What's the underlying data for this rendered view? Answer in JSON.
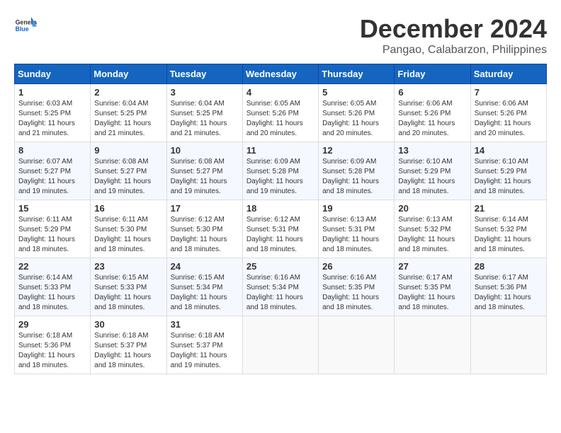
{
  "header": {
    "logo_line1": "General",
    "logo_line2": "Blue",
    "month_title": "December 2024",
    "subtitle": "Pangao, Calabarzon, Philippines"
  },
  "weekdays": [
    "Sunday",
    "Monday",
    "Tuesday",
    "Wednesday",
    "Thursday",
    "Friday",
    "Saturday"
  ],
  "weeks": [
    [
      {
        "day": "1",
        "sunrise": "6:03 AM",
        "sunset": "5:25 PM",
        "daylight": "11 hours and 21 minutes."
      },
      {
        "day": "2",
        "sunrise": "6:04 AM",
        "sunset": "5:25 PM",
        "daylight": "11 hours and 21 minutes."
      },
      {
        "day": "3",
        "sunrise": "6:04 AM",
        "sunset": "5:25 PM",
        "daylight": "11 hours and 21 minutes."
      },
      {
        "day": "4",
        "sunrise": "6:05 AM",
        "sunset": "5:26 PM",
        "daylight": "11 hours and 20 minutes."
      },
      {
        "day": "5",
        "sunrise": "6:05 AM",
        "sunset": "5:26 PM",
        "daylight": "11 hours and 20 minutes."
      },
      {
        "day": "6",
        "sunrise": "6:06 AM",
        "sunset": "5:26 PM",
        "daylight": "11 hours and 20 minutes."
      },
      {
        "day": "7",
        "sunrise": "6:06 AM",
        "sunset": "5:26 PM",
        "daylight": "11 hours and 20 minutes."
      }
    ],
    [
      {
        "day": "8",
        "sunrise": "6:07 AM",
        "sunset": "5:27 PM",
        "daylight": "11 hours and 19 minutes."
      },
      {
        "day": "9",
        "sunrise": "6:08 AM",
        "sunset": "5:27 PM",
        "daylight": "11 hours and 19 minutes."
      },
      {
        "day": "10",
        "sunrise": "6:08 AM",
        "sunset": "5:27 PM",
        "daylight": "11 hours and 19 minutes."
      },
      {
        "day": "11",
        "sunrise": "6:09 AM",
        "sunset": "5:28 PM",
        "daylight": "11 hours and 19 minutes."
      },
      {
        "day": "12",
        "sunrise": "6:09 AM",
        "sunset": "5:28 PM",
        "daylight": "11 hours and 18 minutes."
      },
      {
        "day": "13",
        "sunrise": "6:10 AM",
        "sunset": "5:29 PM",
        "daylight": "11 hours and 18 minutes."
      },
      {
        "day": "14",
        "sunrise": "6:10 AM",
        "sunset": "5:29 PM",
        "daylight": "11 hours and 18 minutes."
      }
    ],
    [
      {
        "day": "15",
        "sunrise": "6:11 AM",
        "sunset": "5:29 PM",
        "daylight": "11 hours and 18 minutes."
      },
      {
        "day": "16",
        "sunrise": "6:11 AM",
        "sunset": "5:30 PM",
        "daylight": "11 hours and 18 minutes."
      },
      {
        "day": "17",
        "sunrise": "6:12 AM",
        "sunset": "5:30 PM",
        "daylight": "11 hours and 18 minutes."
      },
      {
        "day": "18",
        "sunrise": "6:12 AM",
        "sunset": "5:31 PM",
        "daylight": "11 hours and 18 minutes."
      },
      {
        "day": "19",
        "sunrise": "6:13 AM",
        "sunset": "5:31 PM",
        "daylight": "11 hours and 18 minutes."
      },
      {
        "day": "20",
        "sunrise": "6:13 AM",
        "sunset": "5:32 PM",
        "daylight": "11 hours and 18 minutes."
      },
      {
        "day": "21",
        "sunrise": "6:14 AM",
        "sunset": "5:32 PM",
        "daylight": "11 hours and 18 minutes."
      }
    ],
    [
      {
        "day": "22",
        "sunrise": "6:14 AM",
        "sunset": "5:33 PM",
        "daylight": "11 hours and 18 minutes."
      },
      {
        "day": "23",
        "sunrise": "6:15 AM",
        "sunset": "5:33 PM",
        "daylight": "11 hours and 18 minutes."
      },
      {
        "day": "24",
        "sunrise": "6:15 AM",
        "sunset": "5:34 PM",
        "daylight": "11 hours and 18 minutes."
      },
      {
        "day": "25",
        "sunrise": "6:16 AM",
        "sunset": "5:34 PM",
        "daylight": "11 hours and 18 minutes."
      },
      {
        "day": "26",
        "sunrise": "6:16 AM",
        "sunset": "5:35 PM",
        "daylight": "11 hours and 18 minutes."
      },
      {
        "day": "27",
        "sunrise": "6:17 AM",
        "sunset": "5:35 PM",
        "daylight": "11 hours and 18 minutes."
      },
      {
        "day": "28",
        "sunrise": "6:17 AM",
        "sunset": "5:36 PM",
        "daylight": "11 hours and 18 minutes."
      }
    ],
    [
      {
        "day": "29",
        "sunrise": "6:18 AM",
        "sunset": "5:36 PM",
        "daylight": "11 hours and 18 minutes."
      },
      {
        "day": "30",
        "sunrise": "6:18 AM",
        "sunset": "5:37 PM",
        "daylight": "11 hours and 18 minutes."
      },
      {
        "day": "31",
        "sunrise": "6:18 AM",
        "sunset": "5:37 PM",
        "daylight": "11 hours and 19 minutes."
      },
      null,
      null,
      null,
      null
    ]
  ]
}
